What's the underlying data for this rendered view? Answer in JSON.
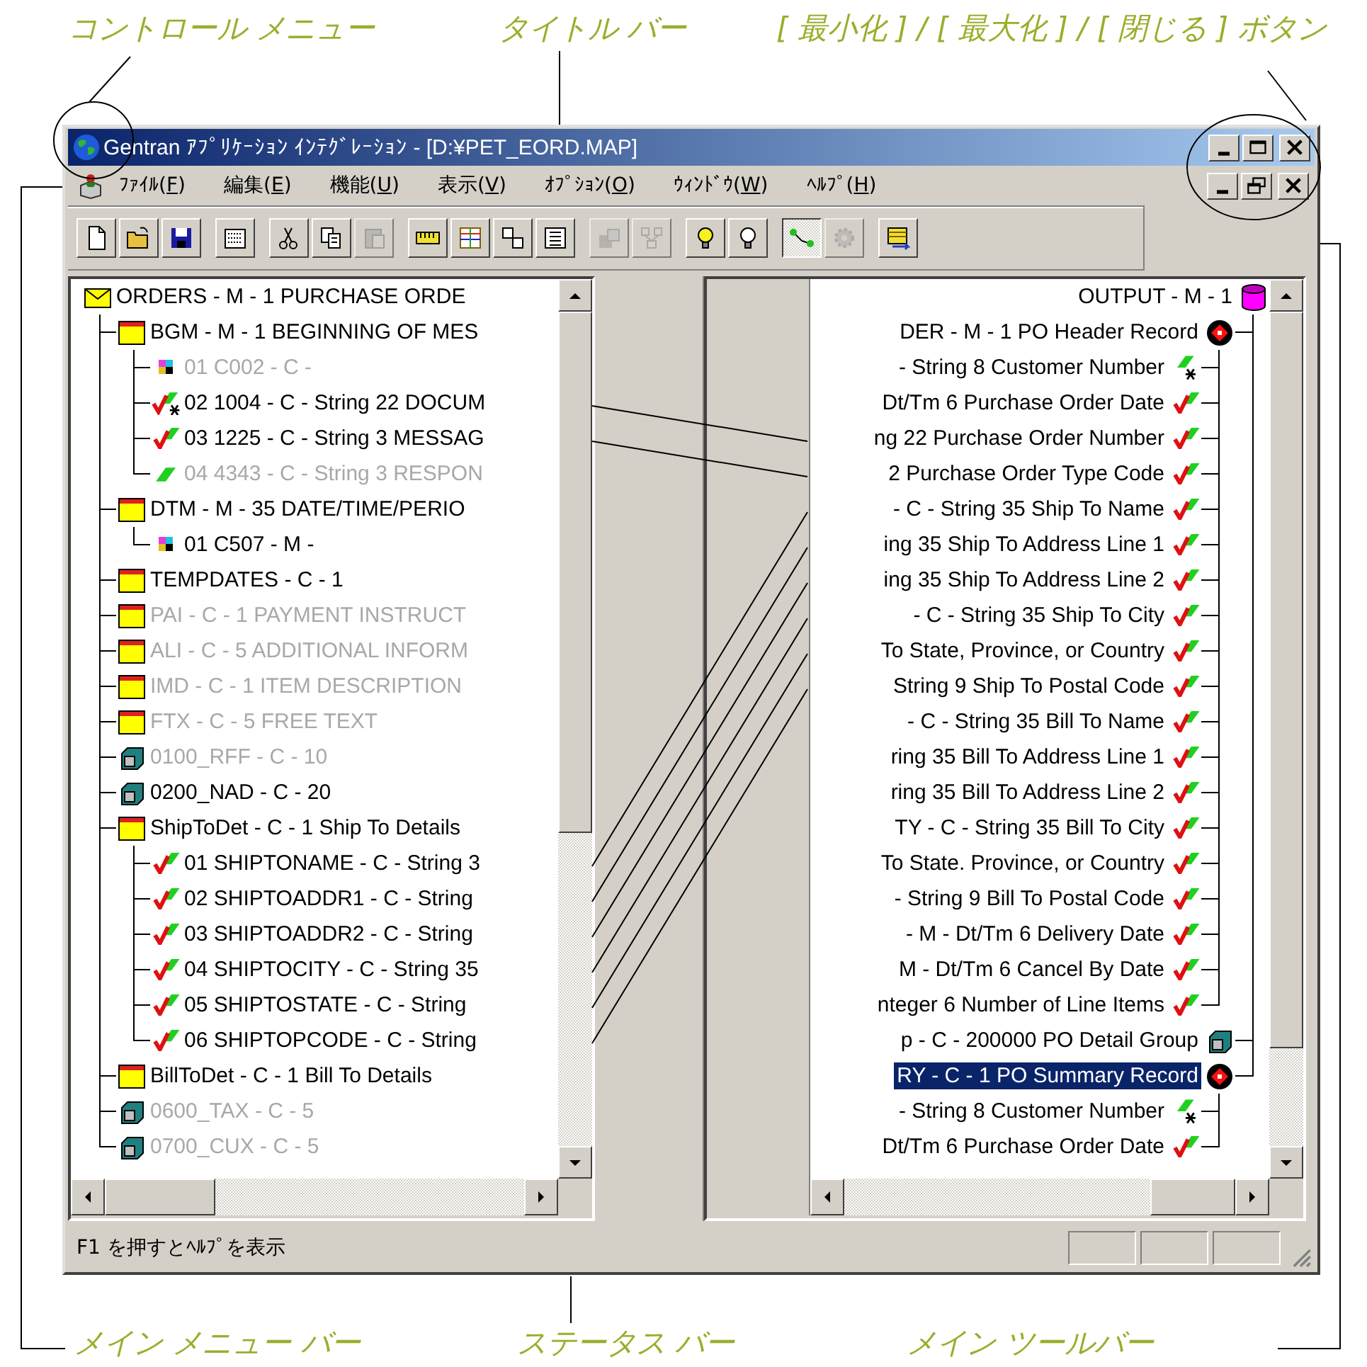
{
  "callouts": {
    "control_menu": "コントロール メニュー",
    "title_bar": "タイトル バー",
    "window_buttons": "[ 最小化 ] / [ 最大化 ] / [ 閉じる ] ボタン",
    "main_menu_bar": "メイン メニュー バー",
    "status_bar": "ステータス バー",
    "main_toolbar": "メイン ツールバー"
  },
  "window": {
    "title": "Gentran ｱﾌﾟﾘｹｰｼｮﾝ ｲﾝﾃｸﾞﾚｰｼｮﾝ - [D:¥PET_EORD.MAP]"
  },
  "menu": [
    "ﾌｧｲﾙ(F)",
    "編集(E)",
    "機能(U)",
    "表示(V)",
    "ｵﾌﾟｼｮﾝ(O)",
    "ｳｨﾝﾄﾞｳ(W)",
    "ﾍﾙﾌﾟ(H)"
  ],
  "toolbar": [
    [
      {
        "kind": "new",
        "disabled": false,
        "pressed": false
      },
      {
        "kind": "open",
        "disabled": false,
        "pressed": false
      },
      {
        "kind": "save",
        "disabled": false,
        "pressed": false
      }
    ],
    [
      {
        "kind": "layout",
        "disabled": false,
        "pressed": false
      }
    ],
    [
      {
        "kind": "cut",
        "disabled": false,
        "pressed": false
      },
      {
        "kind": "copy",
        "disabled": false,
        "pressed": false
      },
      {
        "kind": "paste",
        "disabled": true,
        "pressed": false
      }
    ],
    [
      {
        "kind": "ruler",
        "disabled": false,
        "pressed": false
      },
      {
        "kind": "grid",
        "disabled": false,
        "pressed": false
      },
      {
        "kind": "sort",
        "disabled": false,
        "pressed": false
      },
      {
        "kind": "list",
        "disabled": false,
        "pressed": false
      }
    ],
    [
      {
        "kind": "boxes",
        "disabled": true,
        "pressed": false
      },
      {
        "kind": "network",
        "disabled": true,
        "pressed": false
      }
    ],
    [
      {
        "kind": "bulb",
        "disabled": false,
        "pressed": false
      },
      {
        "kind": "bulb-off",
        "disabled": false,
        "pressed": false
      }
    ],
    [
      {
        "kind": "link",
        "disabled": false,
        "pressed": true
      },
      {
        "kind": "gear",
        "disabled": true,
        "pressed": false
      }
    ],
    [
      {
        "kind": "export",
        "disabled": false,
        "pressed": false
      }
    ]
  ],
  "source_tree": {
    "text": "ORDERS - M -  1 PURCHASE ORDE",
    "kind": "message",
    "dimmed": false,
    "children": [
      {
        "text": "BGM - M -  1 BEGINNING OF MES",
        "kind": "segment",
        "dimmed": false,
        "children": [
          {
            "text": "01 C002 - C -",
            "kind": "composite",
            "dimmed": true
          },
          {
            "text": "02 1004 - C - String 22 DOCUM",
            "kind": "field-linked-key",
            "dimmed": false
          },
          {
            "text": "03 1225 - C - String 3 MESSAG",
            "kind": "field-linked",
            "dimmed": false
          },
          {
            "text": "04 4343 - C - String 3 RESPON",
            "kind": "field",
            "dimmed": true
          }
        ]
      },
      {
        "text": "DTM - M -  35 DATE/TIME/PERIO",
        "kind": "segment",
        "dimmed": false,
        "children": [
          {
            "text": "01 C507 - M -",
            "kind": "composite",
            "dimmed": false
          }
        ]
      },
      {
        "text": "TEMPDATES - C -  1",
        "kind": "segment",
        "dimmed": false
      },
      {
        "text": "PAI - C -  1 PAYMENT INSTRUCT",
        "kind": "segment",
        "dimmed": true
      },
      {
        "text": "ALI - C -  5 ADDITIONAL INFORM",
        "kind": "segment",
        "dimmed": true
      },
      {
        "text": "IMD - C -  1 ITEM DESCRIPTION",
        "kind": "segment",
        "dimmed": true
      },
      {
        "text": "FTX - C -  5 FREE TEXT",
        "kind": "segment",
        "dimmed": true
      },
      {
        "text": "0100_RFF - C -  10",
        "kind": "group",
        "dimmed": true
      },
      {
        "text": "0200_NAD - C -  20",
        "kind": "group",
        "dimmed": false
      },
      {
        "text": "ShipToDet - C -  1 Ship To Details",
        "kind": "segment",
        "dimmed": false,
        "children": [
          {
            "text": "01 SHIPTONAME - C - String 3",
            "kind": "field-linked",
            "dimmed": false
          },
          {
            "text": "02 SHIPTOADDR1 - C - String",
            "kind": "field-linked",
            "dimmed": false
          },
          {
            "text": "03 SHIPTOADDR2 - C - String",
            "kind": "field-linked",
            "dimmed": false
          },
          {
            "text": "04 SHIPTOCITY - C - String 35",
            "kind": "field-linked",
            "dimmed": false
          },
          {
            "text": "05 SHIPTOSTATE - C - String",
            "kind": "field-linked",
            "dimmed": false
          },
          {
            "text": "06 SHIPTOPCODE - C - String",
            "kind": "field-linked",
            "dimmed": false
          }
        ]
      },
      {
        "text": "BillToDet - C -  1 Bill To Details",
        "kind": "segment",
        "dimmed": false
      },
      {
        "text": "0600_TAX - C -  5",
        "kind": "group",
        "dimmed": true
      },
      {
        "text": "0700_CUX - C -  5",
        "kind": "group",
        "dimmed": true
      }
    ]
  },
  "target_tree": {
    "text": "OUTPUT - M -  1",
    "kind": "database",
    "selected": false,
    "children": [
      {
        "text": "DER - M -  1 PO Header Record",
        "kind": "record",
        "selected": false,
        "children": [
          {
            "text": "- String 8 Customer Number",
            "kind": "field-key",
            "selected": false
          },
          {
            "text": "Dt/Tm 6 Purchase Order Date",
            "kind": "field-linked",
            "selected": false
          },
          {
            "text": "ng 22 Purchase Order Number",
            "kind": "field-linked",
            "selected": false
          },
          {
            "text": "2 Purchase Order Type Code",
            "kind": "field-linked",
            "selected": false
          },
          {
            "text": "- C - String 35 Ship To Name",
            "kind": "field-linked",
            "selected": false
          },
          {
            "text": "ing 35 Ship To Address Line 1",
            "kind": "field-linked",
            "selected": false
          },
          {
            "text": "ing 35 Ship To Address Line 2",
            "kind": "field-linked",
            "selected": false
          },
          {
            "text": "- C - String 35 Ship To City",
            "kind": "field-linked",
            "selected": false
          },
          {
            "text": "To State, Province, or Country",
            "kind": "field-linked",
            "selected": false
          },
          {
            "text": "String 9 Ship To Postal Code",
            "kind": "field-linked",
            "selected": false
          },
          {
            "text": "- C - String 35 Bill To Name",
            "kind": "field-linked",
            "selected": false
          },
          {
            "text": "ring 35 Bill To Address Line 1",
            "kind": "field-linked",
            "selected": false
          },
          {
            "text": "ring 35 Bill To Address Line 2",
            "kind": "field-linked",
            "selected": false
          },
          {
            "text": "TY - C - String 35 Bill To City",
            "kind": "field-linked",
            "selected": false
          },
          {
            "text": "To State. Province, or Country",
            "kind": "field-linked",
            "selected": false
          },
          {
            "text": "- String 9 Bill To Postal Code",
            "kind": "field-linked",
            "selected": false
          },
          {
            "text": "- M - Dt/Tm 6 Delivery Date",
            "kind": "field-linked",
            "selected": false
          },
          {
            "text": "M - Dt/Tm 6 Cancel By Date",
            "kind": "field-linked",
            "selected": false
          },
          {
            "text": "nteger 6 Number of Line Items",
            "kind": "field-linked",
            "selected": false
          }
        ]
      },
      {
        "text": "p - C -  200000 PO Detail Group",
        "kind": "group",
        "selected": false
      },
      {
        "text": "RY - C -  1 PO Summary Record",
        "kind": "record",
        "selected": true,
        "children": [
          {
            "text": "- String 8 Customer Number",
            "kind": "field-key",
            "selected": false
          },
          {
            "text": "Dt/Tm 6 Purchase Order Date",
            "kind": "field-linked",
            "selected": false
          }
        ]
      }
    ]
  },
  "status_bar": {
    "text": "F1 を押すとﾍﾙﾌﾟを表示"
  }
}
